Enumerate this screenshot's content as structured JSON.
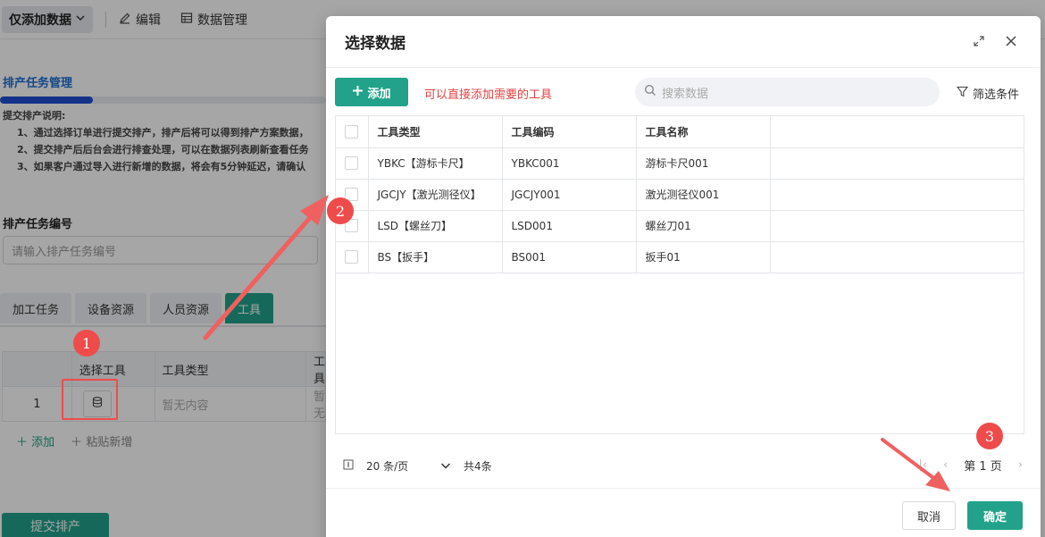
{
  "toolbar": {
    "dropdown_label": "仅添加数据",
    "edit_label": "编辑",
    "data_manage_label": "数据管理"
  },
  "background": {
    "section_title": "排产任务管理",
    "notes": {
      "title": "提交排产说明:",
      "lines": [
        "1、通过选择订单进行提交排产，排产后将可以得到排产方案数据，",
        "2、提交排产后后台会进行排查处理，可以在数据列表刷新查看任务",
        "3、如果客户通过导入进行新增的数据，将会有5分钟延迟，请确认"
      ]
    },
    "task_no_label": "排产任务编号",
    "task_no_placeholder": "请输入排产任务编号",
    "tabs": [
      "加工任务",
      "设备资源",
      "人员资源",
      "工具"
    ],
    "grid": {
      "headers": [
        "",
        "选择工具",
        "工具类型",
        "工具"
      ],
      "row": {
        "index": "1",
        "type": "暂无内容",
        "code": "暂无"
      }
    },
    "add_row_label": "添加",
    "paste_label": "粘贴新增",
    "submit_label": "提交排产"
  },
  "dialog": {
    "title": "选择数据",
    "add_label": "添加",
    "hint": "可以直接添加需要的工具",
    "search_placeholder": "搜索数据",
    "filter_label": "筛选条件",
    "columns": [
      "工具类型",
      "工具编码",
      "工具名称"
    ],
    "rows": [
      {
        "type": "YBKC【游标卡尺】",
        "code": "YBKC001",
        "name": "游标卡尺001"
      },
      {
        "type": "JGCJY【激光测径仪】",
        "code": "JGCJY001",
        "name": "激光测径仪001"
      },
      {
        "type": "LSD【螺丝刀】",
        "code": "LSD001",
        "name": "螺丝刀01"
      },
      {
        "type": "BS【扳手】",
        "code": "BS001",
        "name": "扳手01"
      }
    ],
    "pager": {
      "page_size": "20 条/页",
      "total": "共4条",
      "page": "第 1 页"
    },
    "cancel_label": "取消",
    "confirm_label": "确定"
  },
  "annotations": {
    "marker_1": "1",
    "marker_2": "2",
    "marker_3": "3",
    "color": "#ef4b4b"
  },
  "colors": {
    "primary": "#22a28a",
    "link": "#1f6fd1",
    "hint": "#e3413f"
  }
}
